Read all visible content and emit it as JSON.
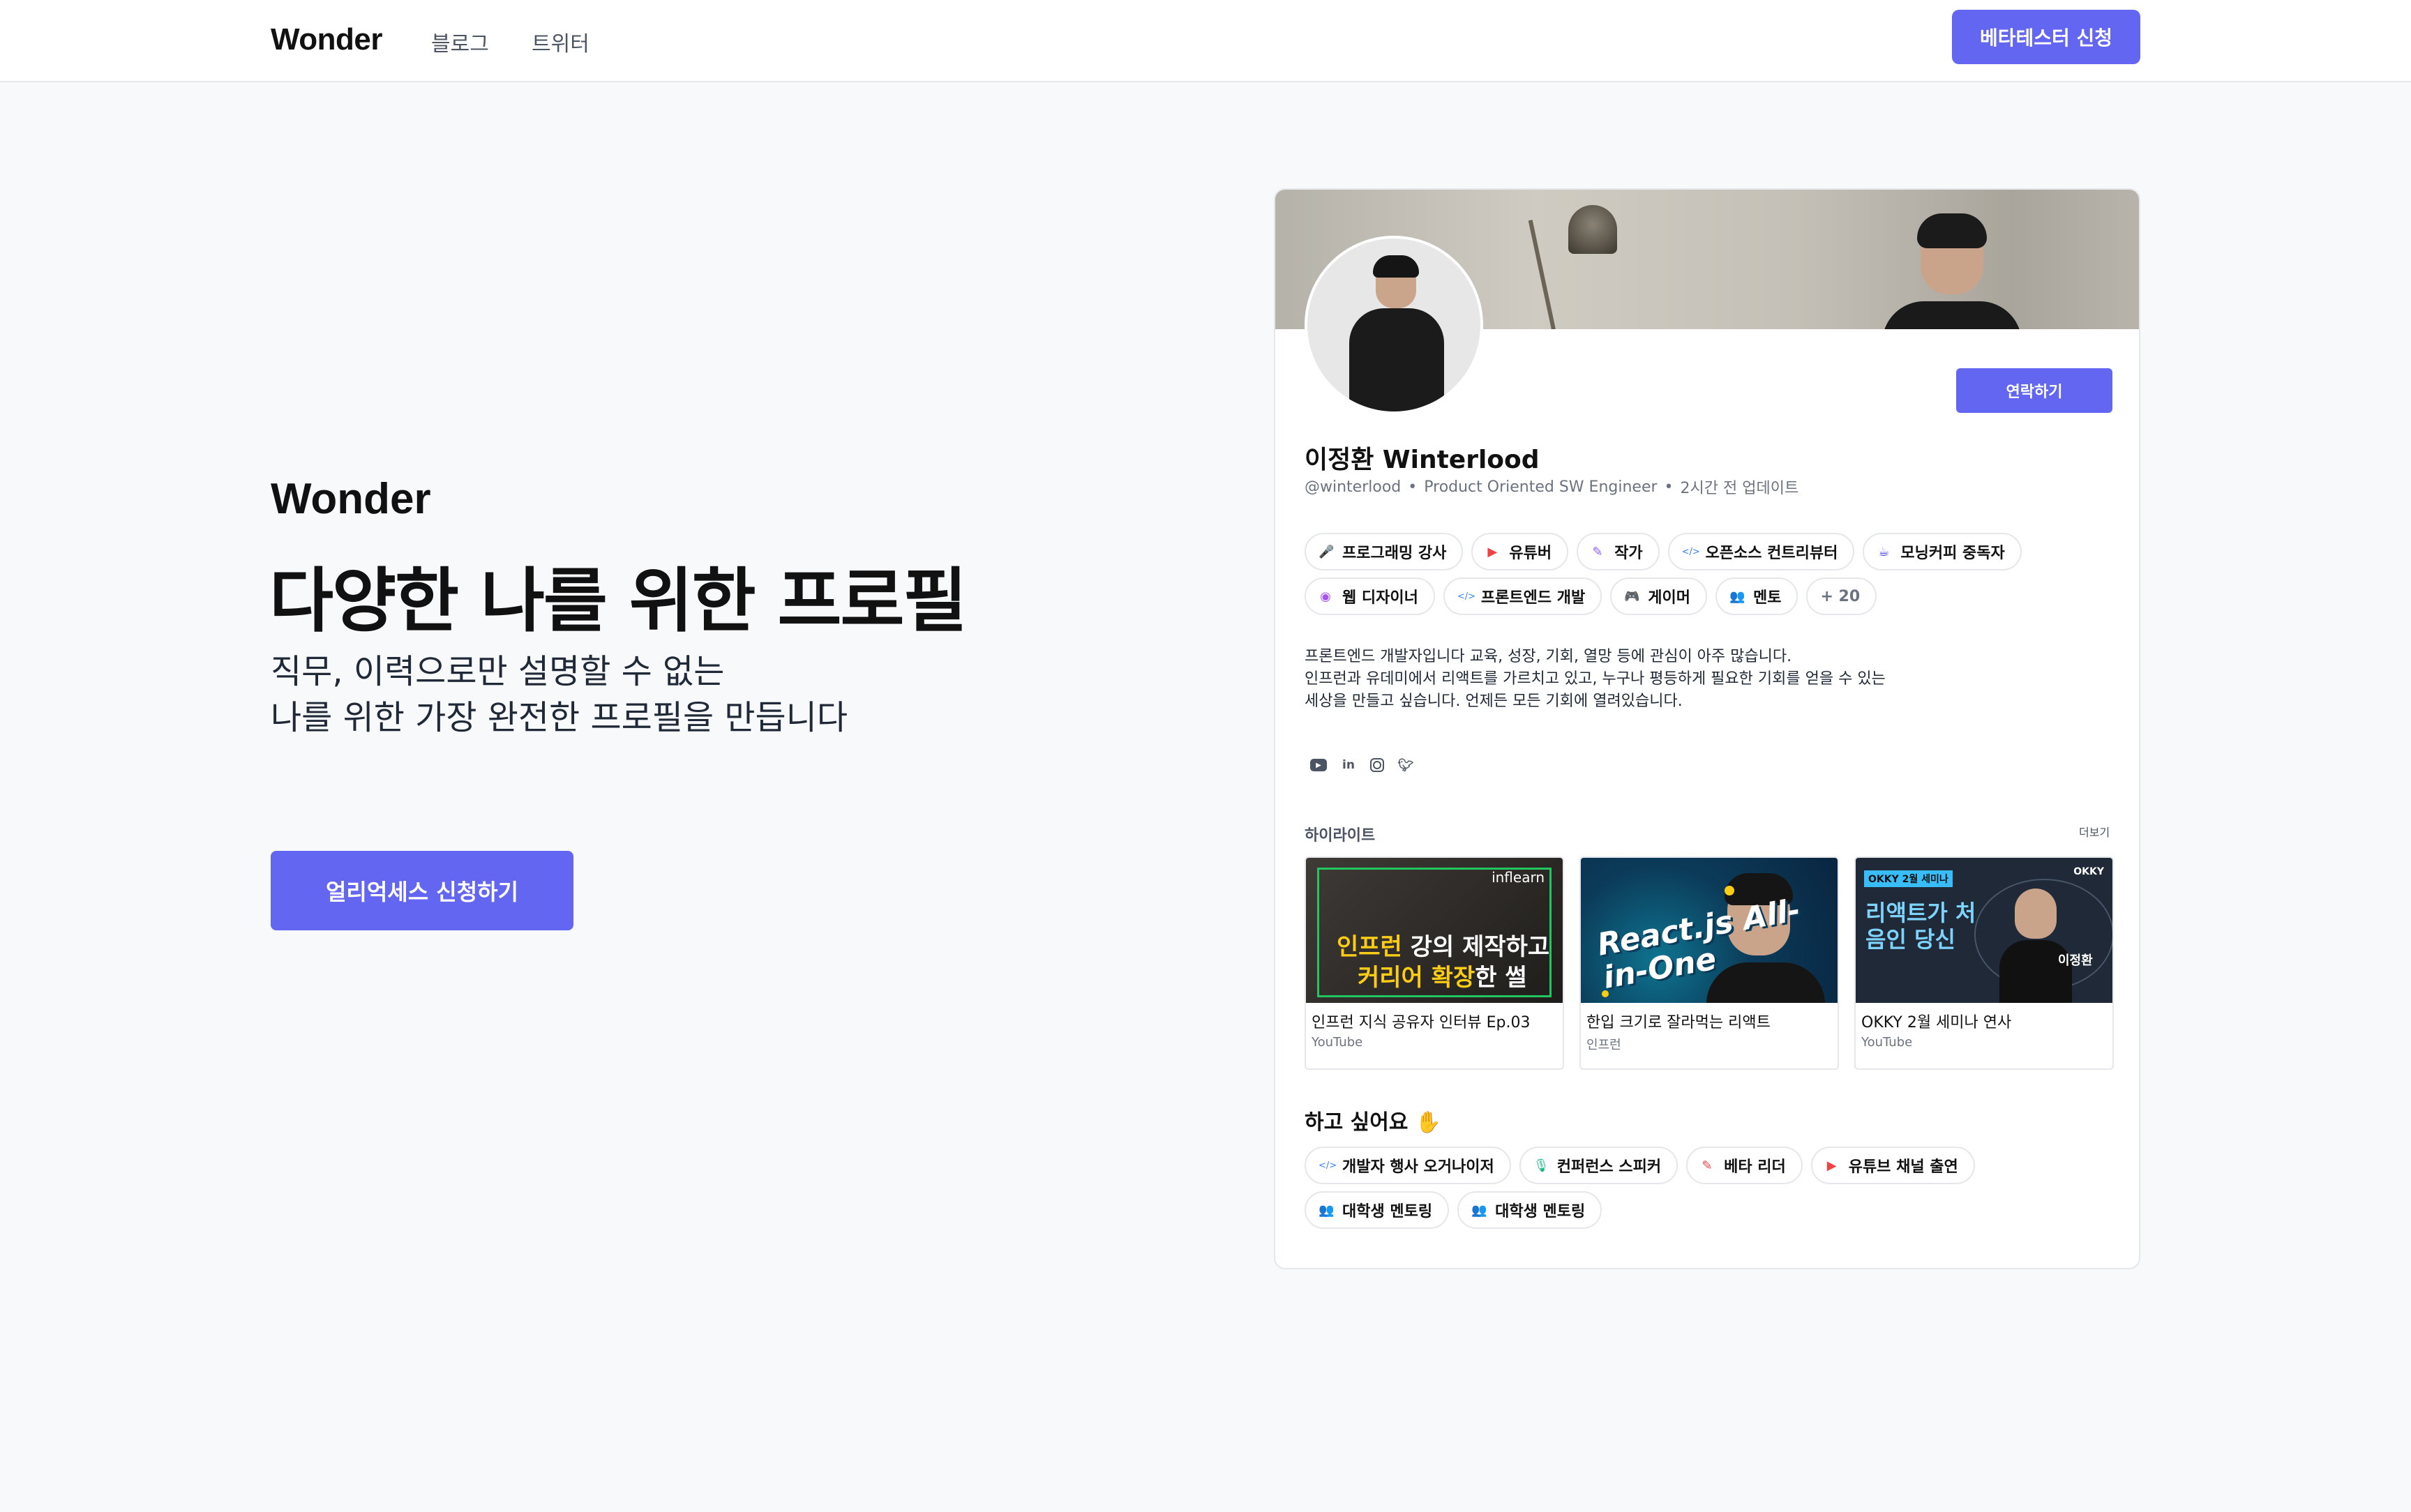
{
  "nav": {
    "logo": "Wonder",
    "links": [
      "블로그",
      "트위터"
    ],
    "beta_button": "베타테스터 신청"
  },
  "hero": {
    "brand": "Wonder",
    "title": "다양한 나를 위한 프로필",
    "subtitle_lines": [
      "직무, 이력으로만 설명할 수 없는",
      "나를 위한 가장 완전한 프로필을 만듭니다"
    ],
    "cta": "얼리억세스 신청하기"
  },
  "profile": {
    "contact_button": "연락하기",
    "name": "이정환 Winterlood",
    "handle": "@winterlood",
    "role": "Product Oriented SW Engineer",
    "updated": "2시간 전 업데이트",
    "tags": [
      {
        "icon": "mic-icon",
        "glyph": "🎤",
        "color": "#ef4444",
        "label": "프로그래밍 강사"
      },
      {
        "icon": "youtube-icon",
        "glyph": "▶",
        "color": "#ef4444",
        "label": "유튜버"
      },
      {
        "icon": "pen-icon",
        "glyph": "✎",
        "color": "#8b5cf6",
        "label": "작가"
      },
      {
        "icon": "code-icon",
        "glyph": "</>",
        "color": "#3b82f6",
        "label": "오픈소스 컨트리뷰터"
      },
      {
        "icon": "coffee-icon",
        "glyph": "☕",
        "color": "#4f46e5",
        "label": "모닝커피 중독자"
      },
      {
        "icon": "palette-icon",
        "glyph": "◉",
        "color": "#a855f7",
        "label": "웹 디자이너"
      },
      {
        "icon": "code-icon",
        "glyph": "</>",
        "color": "#3b82f6",
        "label": "프론트엔드 개발"
      },
      {
        "icon": "gamepad-icon",
        "glyph": "🎮",
        "color": "#f59e0b",
        "label": "게이머"
      },
      {
        "icon": "mentor-icon",
        "glyph": "👥",
        "color": "#60a5fa",
        "label": "멘토"
      }
    ],
    "more_tags": "+ 20",
    "bio_lines": [
      "프론트엔드 개발자입니다 교육, 성장, 기회, 열망 등에 관심이 아주 많습니다.",
      "인프런과 유데미에서 리액트를 가르치고 있고, 누구나 평등하게 필요한 기회를 얻을 수 있는",
      "세상을 만들고 싶습니다. 언제든 모든 기회에 열려있습니다."
    ],
    "socials": [
      "youtube-icon",
      "linkedin-icon",
      "instagram-icon",
      "twitter-icon"
    ],
    "highlights_title": "하이라이트",
    "highlights_more": "더보기",
    "highlights": [
      {
        "title": "인프런 지식 공유자 인터뷰 Ep.03",
        "source": "YouTube",
        "thumb_brand": "inflearn",
        "thumb_line1_accent": "인프런",
        "thumb_line1": " 강의 제작하고",
        "thumb_line2_accent": "커리어 확장",
        "thumb_line2": "한 썰"
      },
      {
        "title": "한입 크기로 잘라먹는 리액트",
        "source": "인프런",
        "thumb_text": "React.js All-in-One"
      },
      {
        "title": "OKKY 2월 세미나 연사",
        "source": "YouTube",
        "thumb_tag": "OKKY 2월 세미나",
        "thumb_brand": "OKKY",
        "thumb_big": "리액트가 처음인 당신",
        "thumb_name": "이정환"
      }
    ],
    "wants_title": "하고 싶어요 ✋",
    "wants": [
      {
        "icon": "code-icon",
        "glyph": "</>",
        "color": "#3b82f6",
        "label": "개발자 행사 오거나이저"
      },
      {
        "icon": "mic-icon",
        "glyph": "🎙",
        "color": "#10b981",
        "label": "컨퍼런스 스피커"
      },
      {
        "icon": "pen-icon",
        "glyph": "✎",
        "color": "#ef4444",
        "label": "베타 리더"
      },
      {
        "icon": "youtube-icon",
        "glyph": "▶",
        "color": "#ef4444",
        "label": "유튜브 채널 출연"
      },
      {
        "icon": "mentor-icon",
        "glyph": "👥",
        "color": "#60a5fa",
        "label": "대학생 멘토링"
      },
      {
        "icon": "mentor-icon",
        "glyph": "👥",
        "color": "#60a5fa",
        "label": "대학생 멘토링"
      }
    ]
  },
  "colors": {
    "accent": "#6366f1",
    "background": "#f8f9fb"
  }
}
